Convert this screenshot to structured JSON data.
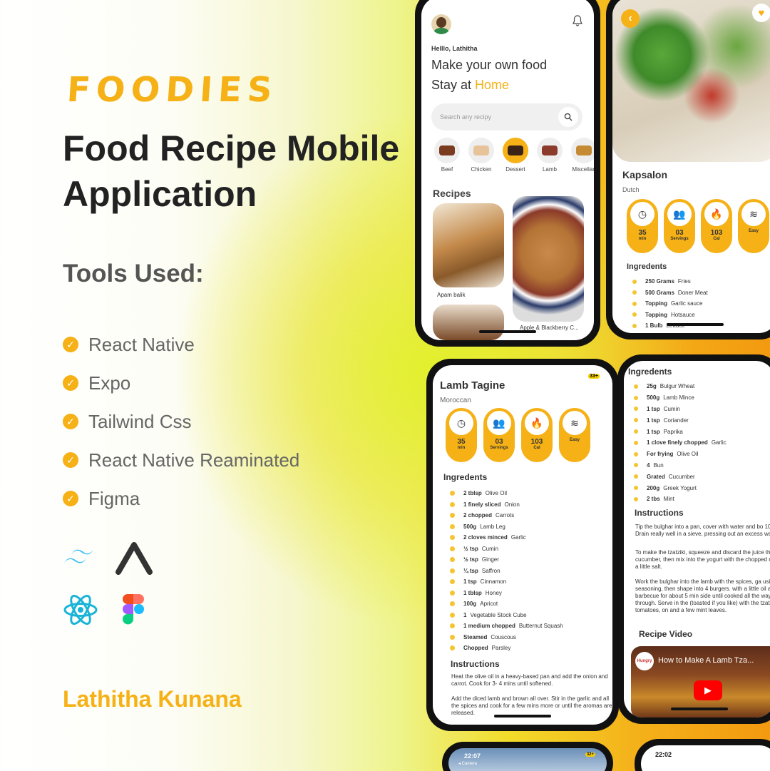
{
  "brand": "FOODIES",
  "headline": {
    "line1": "Food Recipe Mobile",
    "line2": "Application"
  },
  "tools_title": "Tools Used:",
  "tools": [
    "React Native",
    "Expo",
    "Tailwind Css",
    "React Native Reaminated",
    "Figma"
  ],
  "tool_logos": [
    "tailwind-icon",
    "expo-icon",
    "react-icon",
    "figma-icon"
  ],
  "author": "Lathitha Kunana",
  "colors": {
    "accent": "#f5b116",
    "dot": "#f5c531",
    "text": "#333333"
  },
  "home": {
    "greeting": "Helllo, Lathitha",
    "title_line1": "Make your own food",
    "title_line2_prefix": "Stay at ",
    "title_line2_highlight": "Home",
    "search_placeholder": "Search any recipy",
    "categories": [
      "Beef",
      "Chicken",
      "Dessert",
      "Lamb",
      "Miscellan"
    ],
    "recipes_title": "Recipes",
    "recipes": [
      "Apam balik",
      "Apple & Blackberry C..."
    ]
  },
  "kapsalon": {
    "title": "Kapsalon",
    "origin": "Dutch",
    "stats": [
      {
        "value": "35",
        "label": "min",
        "icon": "clock-icon"
      },
      {
        "value": "03",
        "label": "Servings",
        "icon": "users-icon"
      },
      {
        "value": "103",
        "label": "Cal",
        "icon": "flame-icon"
      },
      {
        "value": "",
        "label": "Easy",
        "icon": "layers-icon"
      }
    ],
    "ingredients_title": "Ingredents",
    "ingredients": [
      {
        "qty": "250 Grams",
        "name": "Fries"
      },
      {
        "qty": "500 Grams",
        "name": "Doner Meat"
      },
      {
        "qty": "Topping",
        "name": "Garlic sauce"
      },
      {
        "qty": "Topping",
        "name": "Hotsauce"
      },
      {
        "qty": "1 Bulb",
        "name": "Lettuce"
      }
    ]
  },
  "lamb": {
    "badge": "33+",
    "title": "Lamb Tagine",
    "origin": "Moroccan",
    "stats": [
      {
        "value": "35",
        "label": "min",
        "icon": "clock-icon"
      },
      {
        "value": "03",
        "label": "Servings",
        "icon": "users-icon"
      },
      {
        "value": "103",
        "label": "Cal",
        "icon": "flame-icon"
      },
      {
        "value": "",
        "label": "Easy",
        "icon": "layers-icon"
      }
    ],
    "ingredients_title": "Ingredents",
    "ingredients": [
      {
        "qty": "2 tblsp",
        "name": "Olive Oil"
      },
      {
        "qty": "1 finely sliced",
        "name": "Onion"
      },
      {
        "qty": "2 chopped",
        "name": "Carrots"
      },
      {
        "qty": "500g",
        "name": "Lamb Leg"
      },
      {
        "qty": "2 cloves minced",
        "name": "Garlic"
      },
      {
        "qty": "½ tsp",
        "name": "Cumin"
      },
      {
        "qty": "½ tsp",
        "name": "Ginger"
      },
      {
        "qty": "¼ tsp",
        "name": "Saffron"
      },
      {
        "qty": "1 tsp",
        "name": "Cinnamon"
      },
      {
        "qty": "1 tblsp",
        "name": "Honey"
      },
      {
        "qty": "100g",
        "name": "Apricot"
      },
      {
        "qty": "1",
        "name": "Vegetable Stock Cube"
      },
      {
        "qty": "1 medium chopped",
        "name": "Butternut Squash"
      },
      {
        "qty": "Steamed",
        "name": "Couscous"
      },
      {
        "qty": "Chopped",
        "name": "Parsley"
      }
    ],
    "instructions_title": "Instructions",
    "instructions": [
      "Heat the olive oil in a heavy-based pan and add the onion and carrot. Cook for 3- 4 mins until softened.",
      "Add the diced lamb and brown all over. Stir in the garlic and all the spices and cook for a few mins more or until the aromas are released."
    ]
  },
  "kofta": {
    "ingredients_title": "Ingredents",
    "ingredients": [
      {
        "qty": "25g",
        "name": "Bulgur Wheat"
      },
      {
        "qty": "500g",
        "name": "Lamb Mince"
      },
      {
        "qty": "1 tsp",
        "name": "Cumin"
      },
      {
        "qty": "1 tsp",
        "name": "Coriander"
      },
      {
        "qty": "1 tsp",
        "name": "Paprika"
      },
      {
        "qty": "1 clove finely chopped",
        "name": "Garlic"
      },
      {
        "qty": "For frying",
        "name": "Olive Oil"
      },
      {
        "qty": "4",
        "name": "Bun"
      },
      {
        "qty": "Grated",
        "name": "Cucumber"
      },
      {
        "qty": "200g",
        "name": "Greek Yogurt"
      },
      {
        "qty": "2 tbs",
        "name": "Mint"
      }
    ],
    "instructions_title": "Instructions",
    "instructions": [
      "Tip the bulghar into a pan, cover with water and bo 10 mins. Drain really well in a sieve, pressing out an excess water.",
      "To make the tzatziki, squeeze and discard the juice the cucumber, then mix into the yogurt with the chopped mint and a little salt.",
      "Work the bulghar into the lamb with the spices, ga using) and seasoning, then shape into 4 burgers. with a little oil and fry or barbecue for about 5 min side until cooked all the way through. Serve in the (toasted if you like) with the tzatziki, tomatoes, on and a few mint leaves."
    ],
    "video_title": "Recipe Video",
    "video_caption": "How to Make A Lamb Tza...",
    "video_channel": "Hungry"
  },
  "bottom_left": {
    "time": "22:07",
    "back": "◂ Camera",
    "badge": "32+"
  },
  "bottom_right": {
    "time": "22:02"
  }
}
